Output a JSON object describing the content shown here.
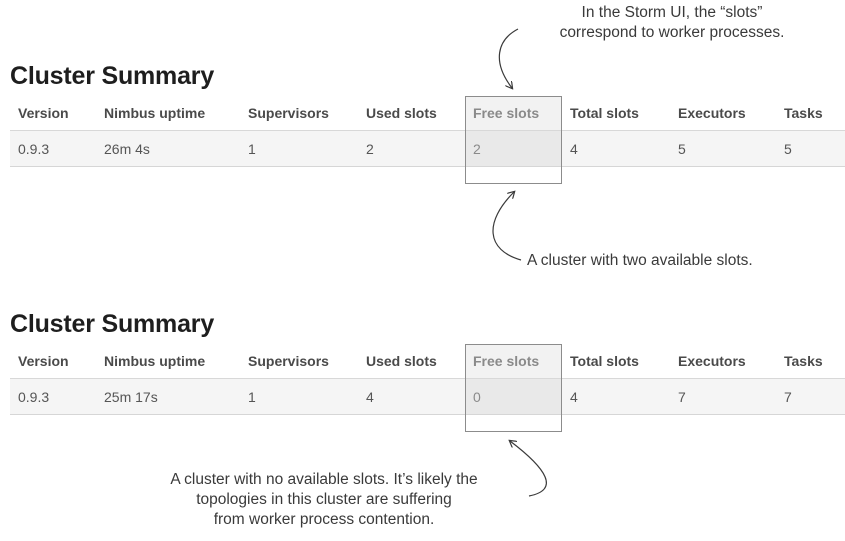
{
  "annotations": {
    "top": [
      "In the Storm UI, the “slots”",
      "correspond to worker processes."
    ],
    "middle": "A cluster with two available slots.",
    "bottom": [
      "A cluster with no available slots. It’s likely the",
      "topologies in this cluster are suffering",
      "from worker process contention."
    ]
  },
  "clusters": [
    {
      "title": "Cluster Summary",
      "headers": [
        "Version",
        "Nimbus uptime",
        "Supervisors",
        "Used slots",
        "Free slots",
        "Total slots",
        "Executors",
        "Tasks"
      ],
      "row": [
        "0.9.3",
        "26m 4s",
        "1",
        "2",
        "2",
        "4",
        "5",
        "5"
      ]
    },
    {
      "title": "Cluster Summary",
      "headers": [
        "Version",
        "Nimbus uptime",
        "Supervisors",
        "Used slots",
        "Free slots",
        "Total slots",
        "Executors",
        "Tasks"
      ],
      "row": [
        "0.9.3",
        "25m 17s",
        "1",
        "4",
        "0",
        "4",
        "7",
        "7"
      ]
    }
  ],
  "highlighted_column": "Free slots",
  "colors": {
    "highlight_border": "#8c8c8c",
    "row_background": "#f5f5f5",
    "highlight_cell": "#e9e9e9"
  }
}
